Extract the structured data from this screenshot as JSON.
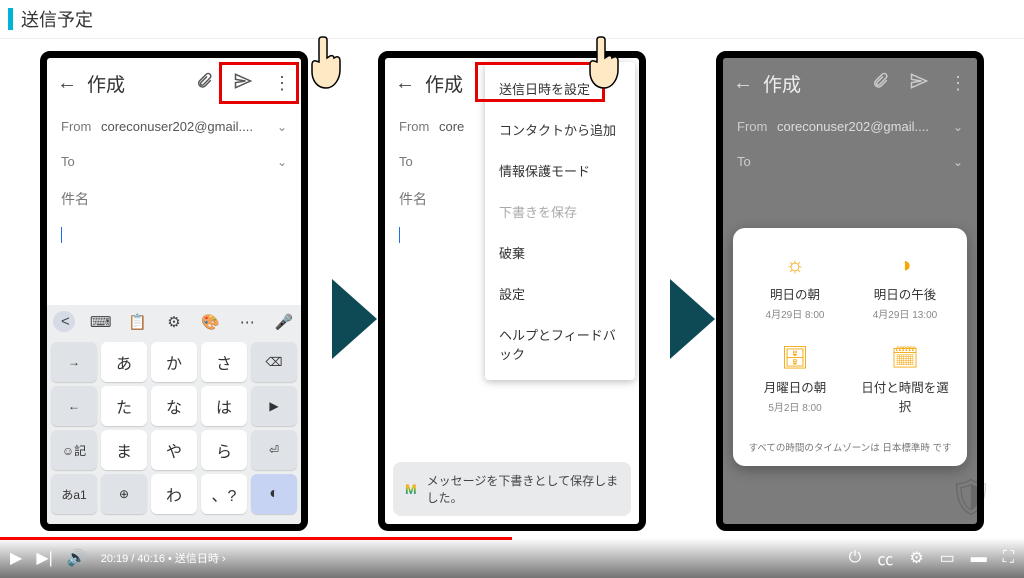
{
  "header": {
    "title": "送信予定"
  },
  "phone1": {
    "composeTitle": "作成",
    "fromLabel": "From",
    "fromValue": "coreconuser202@gmail....",
    "toLabel": "To",
    "subject": "件名",
    "keyboard": {
      "rows": [
        [
          "→",
          "あ",
          "か",
          "さ",
          "⌫"
        ],
        [
          "←",
          "た",
          "な",
          "は",
          "▶"
        ],
        [
          "☺記",
          "ま",
          "や",
          "ら",
          "⏎"
        ],
        [
          "あa1",
          "⊕",
          "わ",
          "、?",
          "◐"
        ]
      ],
      "toolbar": [
        "<",
        "⌨",
        "📋",
        "⚙",
        "🎨",
        "⋯",
        "🎤"
      ]
    }
  },
  "phone2": {
    "composeTitle": "作成",
    "fromLabel": "From",
    "fromValue": "core",
    "toLabel": "To",
    "subject": "件名",
    "menu": [
      "送信日時を設定",
      "コンタクトから追加",
      "情報保護モード",
      "下書きを保存",
      "破棄",
      "設定",
      "ヘルプとフィードバック"
    ],
    "snackbar": "メッセージを下書きとして保存しました。"
  },
  "phone3": {
    "composeTitle": "作成",
    "fromLabel": "From",
    "fromValue": "coreconuser202@gmail....",
    "toLabel": "To",
    "schedule": {
      "items": [
        {
          "title": "明日の朝",
          "sub": "4月29日 8:00",
          "icon": "sun"
        },
        {
          "title": "明日の午後",
          "sub": "4月29日 13:00",
          "icon": "sun-half"
        },
        {
          "title": "月曜日の朝",
          "sub": "5月2日 8:00",
          "icon": "briefcase"
        },
        {
          "title": "日付と時間を選択",
          "sub": "",
          "icon": "calendar"
        }
      ],
      "footer": "すべての時間のタイムゾーンは 日本標準時 です"
    }
  },
  "video": {
    "current": "20:19",
    "total": "40:16",
    "chapter": "送信日時",
    "progressPct": 50
  }
}
